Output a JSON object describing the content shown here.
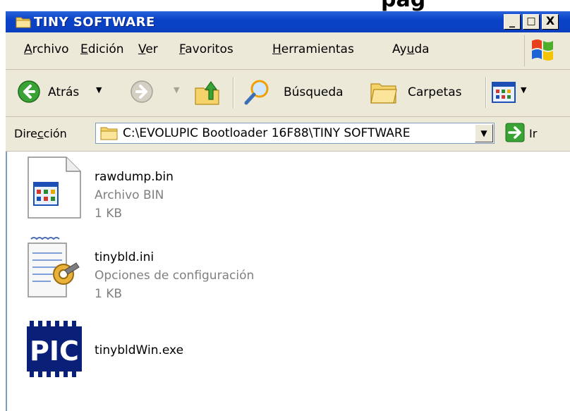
{
  "background_text": "pag",
  "window": {
    "title": "TINY SOFTWARE",
    "buttons": {
      "minimize": "_",
      "maximize": "□",
      "close": "X"
    }
  },
  "menu": [
    {
      "mnemonic": "A",
      "rest": "rchivo"
    },
    {
      "mnemonic": "E",
      "rest": "dición"
    },
    {
      "mnemonic": "V",
      "rest": "er"
    },
    {
      "mnemonic": "F",
      "rest": "avoritos"
    },
    {
      "mnemonic": "H",
      "rest": "erramientas"
    },
    {
      "pre": "Ay",
      "mnemonic": "u",
      "rest": "da"
    }
  ],
  "toolbar": {
    "back_label": "Atrás",
    "search_label": "Búsqueda",
    "folders_label": "Carpetas"
  },
  "address": {
    "label_pre": "Dire",
    "label_mnemonic": "c",
    "label_post": "ción",
    "value": "C:\\EVOLUPIC Bootloader 16F88\\TINY SOFTWARE",
    "go_label": "Ir"
  },
  "files": [
    {
      "name": "rawdump.bin",
      "type": "Archivo BIN",
      "size": "1 KB",
      "icon": "bin-file-icon"
    },
    {
      "name": "tinybld.ini",
      "type": "Opciones de configuración",
      "size": "1 KB",
      "icon": "ini-settings-icon"
    },
    {
      "name": "tinybldWin.exe",
      "icon": "pic-chip-icon"
    }
  ],
  "colors": {
    "title_bar": "#0a43c8",
    "chrome": "#ece9d8",
    "meta_text": "#808080"
  }
}
